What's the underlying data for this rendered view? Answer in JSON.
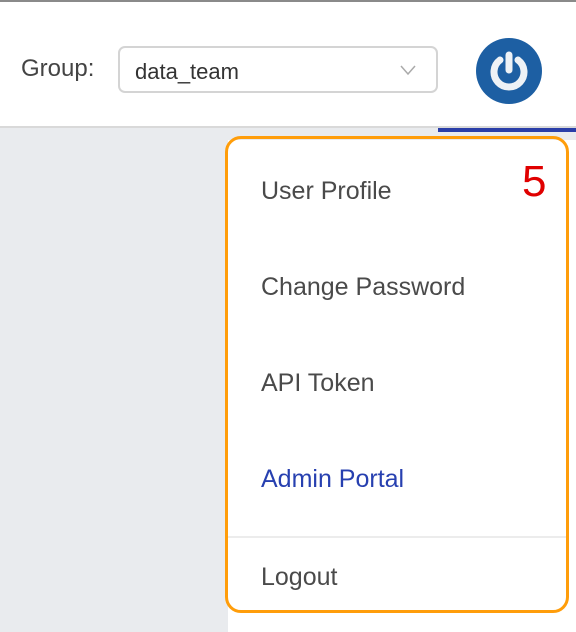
{
  "header": {
    "group_label": "Group:",
    "group_value": "data_team",
    "avatar_icon": "power-icon"
  },
  "menu": {
    "items": [
      {
        "label": "User Profile"
      },
      {
        "label": "Change Password"
      },
      {
        "label": "API Token"
      },
      {
        "label": "Admin Portal"
      },
      {
        "label": "Logout"
      }
    ]
  },
  "annotation": {
    "number": "5",
    "color": "#ff9d0a"
  }
}
